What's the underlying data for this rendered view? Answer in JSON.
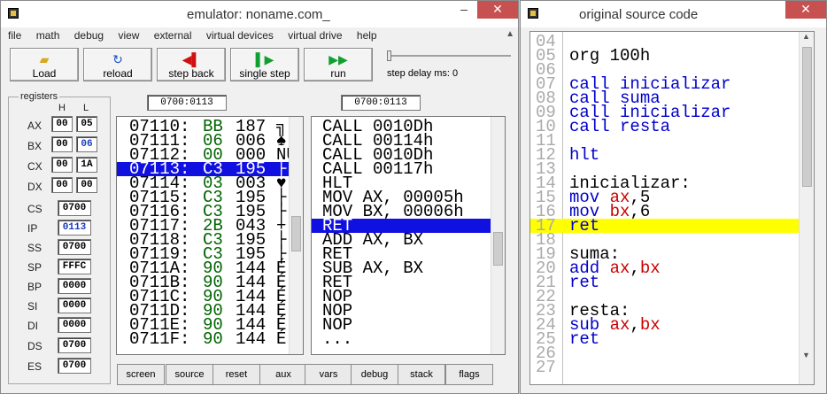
{
  "emulator": {
    "title": "emulator: noname.com_",
    "menu": [
      "file",
      "math",
      "debug",
      "view",
      "external",
      "virtual devices",
      "virtual drive",
      "help"
    ],
    "toolbar": {
      "load": "Load",
      "reload": "reload",
      "step_back": "step back",
      "single_step": "single step",
      "run": "run",
      "step_delay": "step delay ms: 0",
      "step_delay_fraction": 0
    },
    "registers": {
      "group_label": "registers",
      "h": "H",
      "l": "L",
      "ax": {
        "label": "AX",
        "h": "00",
        "l": "05"
      },
      "bx": {
        "label": "BX",
        "h": "00",
        "l": "06"
      },
      "cx": {
        "label": "CX",
        "h": "00",
        "l": "1A"
      },
      "dx": {
        "label": "DX",
        "h": "00",
        "l": "00"
      },
      "cs": {
        "label": "CS",
        "v": "0700"
      },
      "ip": {
        "label": "IP",
        "v": "0113"
      },
      "ss": {
        "label": "SS",
        "v": "0700"
      },
      "sp": {
        "label": "SP",
        "v": "FFFC"
      },
      "bp": {
        "label": "BP",
        "v": "0000"
      },
      "si": {
        "label": "SI",
        "v": "0000"
      },
      "di": {
        "label": "DI",
        "v": "0000"
      },
      "ds": {
        "label": "DS",
        "v": "0700"
      },
      "es": {
        "label": "ES",
        "v": "0700"
      }
    },
    "mem_addr": "0700:0113",
    "dis_addr": "0700:0113",
    "memory": [
      {
        "a": "07110:",
        "h": "BB",
        "d": "187",
        "c": "╗"
      },
      {
        "a": "07111:",
        "h": "06",
        "d": "006",
        "c": "♠"
      },
      {
        "a": "07112:",
        "h": "00",
        "d": "000",
        "c": "NU"
      },
      {
        "a": "07113:",
        "h": "C3",
        "d": "195",
        "c": "├"
      },
      {
        "a": "07114:",
        "h": "03",
        "d": "003",
        "c": "♥"
      },
      {
        "a": "07115:",
        "h": "C3",
        "d": "195",
        "c": "├"
      },
      {
        "a": "07116:",
        "h": "C3",
        "d": "195",
        "c": "├"
      },
      {
        "a": "07117:",
        "h": "2B",
        "d": "043",
        "c": "+"
      },
      {
        "a": "07118:",
        "h": "C3",
        "d": "195",
        "c": "├"
      },
      {
        "a": "07119:",
        "h": "C3",
        "d": "195",
        "c": "├"
      },
      {
        "a": "0711A:",
        "h": "90",
        "d": "144",
        "c": "É"
      },
      {
        "a": "0711B:",
        "h": "90",
        "d": "144",
        "c": "É"
      },
      {
        "a": "0711C:",
        "h": "90",
        "d": "144",
        "c": "É"
      },
      {
        "a": "0711D:",
        "h": "90",
        "d": "144",
        "c": "É"
      },
      {
        "a": "0711E:",
        "h": "90",
        "d": "144",
        "c": "É"
      },
      {
        "a": "0711F:",
        "h": "90",
        "d": "144",
        "c": "É"
      }
    ],
    "disasm": [
      "CALL 0010Dh",
      "CALL 00114h",
      "CALL 0010Dh",
      "CALL 00117h",
      "HLT",
      "MOV AX, 00005h",
      "MOV BX, 00006h",
      "RET",
      "ADD AX, BX",
      "RET",
      "SUB AX, BX",
      "RET",
      "NOP",
      "NOP",
      "NOP",
      "..."
    ],
    "bottom_buttons": [
      "screen",
      "source",
      "reset",
      "aux",
      "vars",
      "debug",
      "stack",
      "flags"
    ]
  },
  "source": {
    "title": "original source code",
    "lines": [
      {
        "n": "04",
        "t": ""
      },
      {
        "n": "05",
        "t": "org 100h"
      },
      {
        "n": "06",
        "t": ""
      },
      {
        "n": "07",
        "t": "call inicializar"
      },
      {
        "n": "08",
        "t": "call suma"
      },
      {
        "n": "09",
        "t": "call inicializar"
      },
      {
        "n": "10",
        "t": "call resta"
      },
      {
        "n": "11",
        "t": ""
      },
      {
        "n": "12",
        "t": "hlt"
      },
      {
        "n": "13",
        "t": ""
      },
      {
        "n": "14",
        "t": "inicializar:"
      },
      {
        "n": "15",
        "t": "mov ax,5"
      },
      {
        "n": "16",
        "t": "mov bx,6"
      },
      {
        "n": "17",
        "t": "ret"
      },
      {
        "n": "18",
        "t": ""
      },
      {
        "n": "19",
        "t": "suma:"
      },
      {
        "n": "20",
        "t": "add ax,bx"
      },
      {
        "n": "21",
        "t": "ret"
      },
      {
        "n": "22",
        "t": ""
      },
      {
        "n": "23",
        "t": "resta:"
      },
      {
        "n": "24",
        "t": "sub ax,bx"
      },
      {
        "n": "25",
        "t": "ret"
      },
      {
        "n": "26",
        "t": ""
      },
      {
        "n": "27",
        "t": ""
      }
    ]
  },
  "colors": {
    "selection": "#1010e0",
    "highlight": "#ffff00",
    "keyword": "#0000cc",
    "register": "#cc0000",
    "hex": "#006400"
  }
}
